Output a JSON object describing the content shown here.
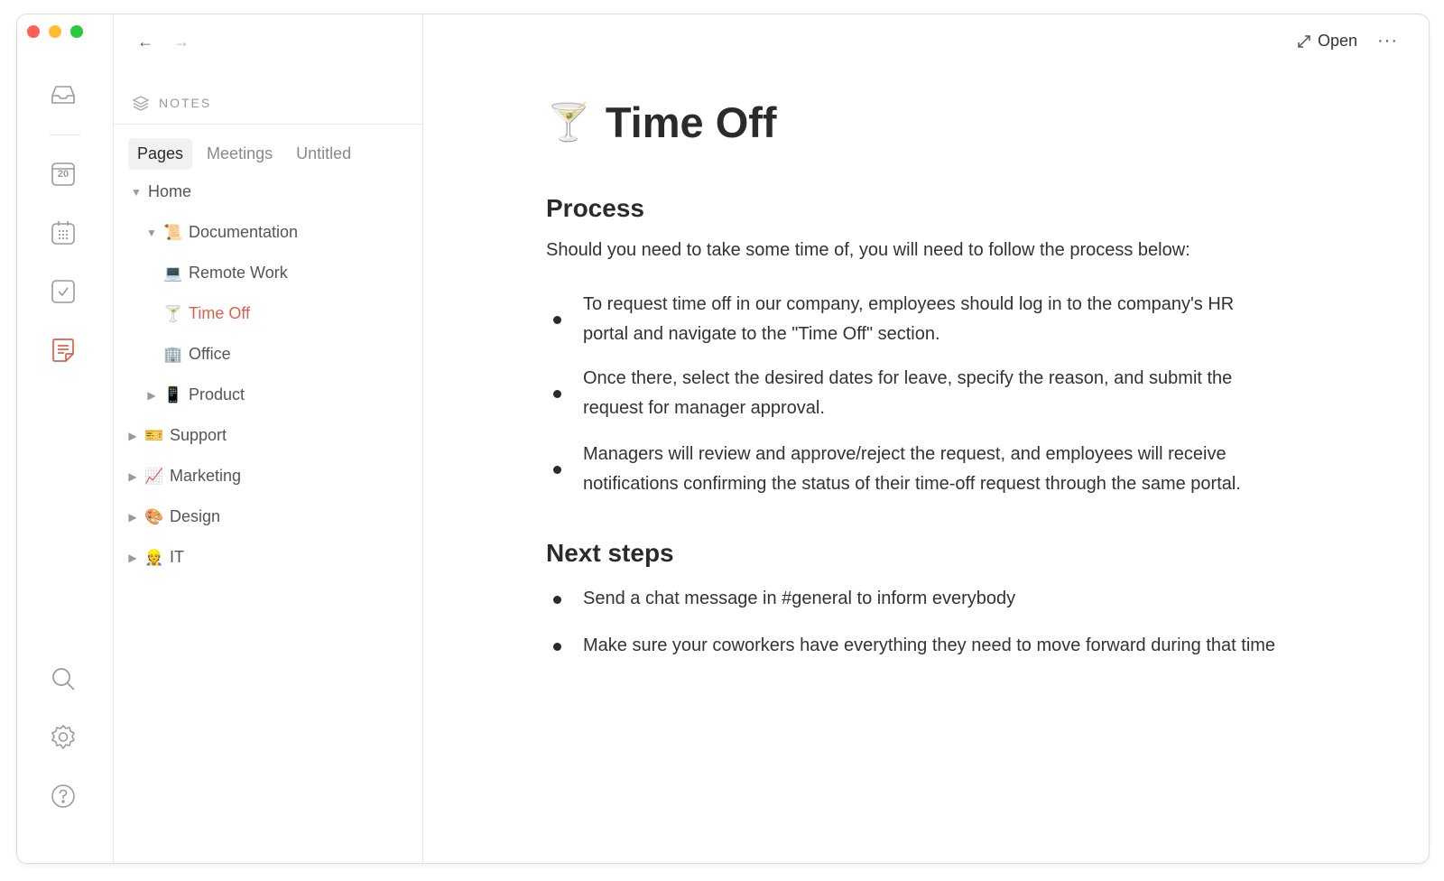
{
  "window": {
    "traffic_lights": {
      "close": "#ff5f57",
      "minimize": "#febc2e",
      "zoom": "#28c840"
    }
  },
  "rail": {
    "calendar_day": "20",
    "icons": [
      "inbox-icon",
      "calendar-day-icon",
      "calendar-grid-icon",
      "tasks-check-icon",
      "notes-icon",
      "search-icon",
      "gear-icon",
      "help-icon"
    ],
    "active_color": "#d9614c"
  },
  "sidebar": {
    "section_label": "NOTES",
    "tabs": [
      {
        "label": "Pages",
        "active": true
      },
      {
        "label": "Meetings",
        "active": false
      },
      {
        "label": "Untitled",
        "active": false
      }
    ],
    "tree": [
      {
        "label": "Home",
        "caret": "▼",
        "emoji": ""
      },
      {
        "label": "Documentation",
        "caret": "▼",
        "emoji": "📜"
      },
      {
        "label": "Remote Work",
        "caret": "",
        "emoji": "💻"
      },
      {
        "label": "Time Off",
        "caret": "",
        "emoji": "🍸",
        "active": true
      },
      {
        "label": "Office",
        "caret": "",
        "emoji": "🏢"
      },
      {
        "label": "Product",
        "caret": "▶",
        "emoji": "📱"
      },
      {
        "label": "Support",
        "caret": "▶",
        "emoji": "🎫"
      },
      {
        "label": "Marketing",
        "caret": "▶",
        "emoji": "📈"
      },
      {
        "label": "Design",
        "caret": "▶",
        "emoji": "🎨"
      },
      {
        "label": "IT",
        "caret": "▶",
        "emoji": "👷"
      }
    ]
  },
  "main": {
    "open_label": "Open",
    "more_label": "···",
    "title_emoji": "🍸",
    "title": "Time Off",
    "process": {
      "heading": "Process",
      "intro": "Should you need to take some time of, you will need to follow the process below:",
      "items": [
        "To request time off in our company, employees should log in to the company's HR portal and navigate to the \"Time Off\" section.",
        "Once there, select the desired dates for leave, specify the reason, and submit the request for manager approval.",
        "Managers will review and approve/reject the request, and employees will receive notifications confirming the status of their time-off request through the same portal."
      ]
    },
    "next_steps": {
      "heading": "Next steps",
      "items": [
        "Send a chat message in #general to inform everybody",
        "Make sure your coworkers have everything they need to move forward during that time"
      ]
    }
  }
}
